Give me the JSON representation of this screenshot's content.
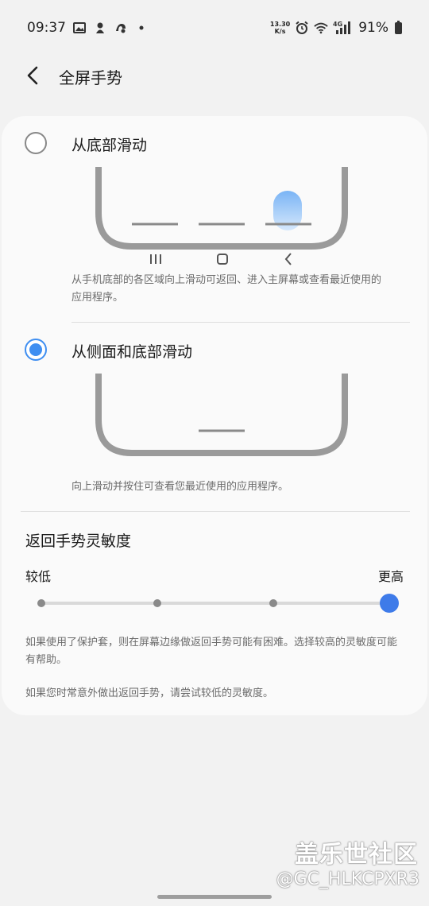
{
  "status_bar": {
    "time": "09:37",
    "net_speed_value": "13.30",
    "net_speed_unit": "K/s",
    "network_type": "4G",
    "battery": "91%",
    "left_icons": [
      "image-icon",
      "app-icon",
      "app-icon",
      "dot-icon"
    ],
    "right_icons": [
      "alarm-icon",
      "wifi-icon",
      "signal-icon",
      "battery-icon"
    ]
  },
  "header": {
    "back_icon": "chevron-left-icon",
    "title": "全屏手势"
  },
  "options": [
    {
      "label": "从底部滑动",
      "selected": false,
      "description": "从手机底部的各区域向上滑动可返回、进入主屏幕或查看最近使用的应用程序。",
      "nav_icons": [
        "recents-icon",
        "home-icon",
        "back-icon"
      ]
    },
    {
      "label": "从侧面和底部滑动",
      "selected": true,
      "description": "向上滑动并按住可查看您最近使用的应用程序。"
    }
  ],
  "sensitivity": {
    "title": "返回手势灵敏度",
    "low_label": "较低",
    "high_label": "更高",
    "steps": 4,
    "current_step": 4,
    "note1": "如果使用了保护套，则在屏幕边缘做返回手势可能有困难。选择较高的灵敏度可能有帮助。",
    "note2": "如果您时常意外做出返回手势，请尝试较低的灵敏度。"
  },
  "watermark": {
    "line1": "盖乐世社区",
    "line2": "@GC_HLKCPXR3"
  },
  "colors": {
    "accent": "#3e8ef1",
    "slider_thumb": "#3e7be9",
    "background": "#f2f2f2",
    "card": "#fafafa"
  }
}
